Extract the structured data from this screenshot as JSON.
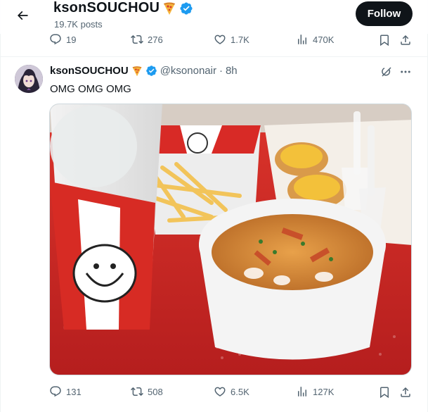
{
  "header": {
    "name": "ksonSOUCHOU",
    "posts": "19.7K posts",
    "follow_label": "Follow"
  },
  "prev_actions": {
    "replies": "19",
    "reposts": "276",
    "likes": "1.7K",
    "views": "470K"
  },
  "tweet": {
    "display_name": "ksonSOUCHOU",
    "handle": "@ksononair",
    "separator": "·",
    "time": "8h",
    "text": "OMG OMG OMG",
    "actions": {
      "replies": "131",
      "reposts": "508",
      "likes": "6.5K",
      "views": "127K"
    }
  },
  "icons": {
    "back": "arrow-left-icon",
    "emoji": "pizza-icon",
    "verified": "verified-badge-icon",
    "reply": "reply-icon",
    "repost": "repost-icon",
    "like": "heart-icon",
    "views": "views-icon",
    "bookmark": "bookmark-icon",
    "share": "share-icon",
    "grok": "grok-icon",
    "more": "more-icon"
  },
  "colors": {
    "accent": "#1d9bf0",
    "text_primary": "#0f1419",
    "text_secondary": "#536471",
    "follow_bg": "#0f1419"
  }
}
